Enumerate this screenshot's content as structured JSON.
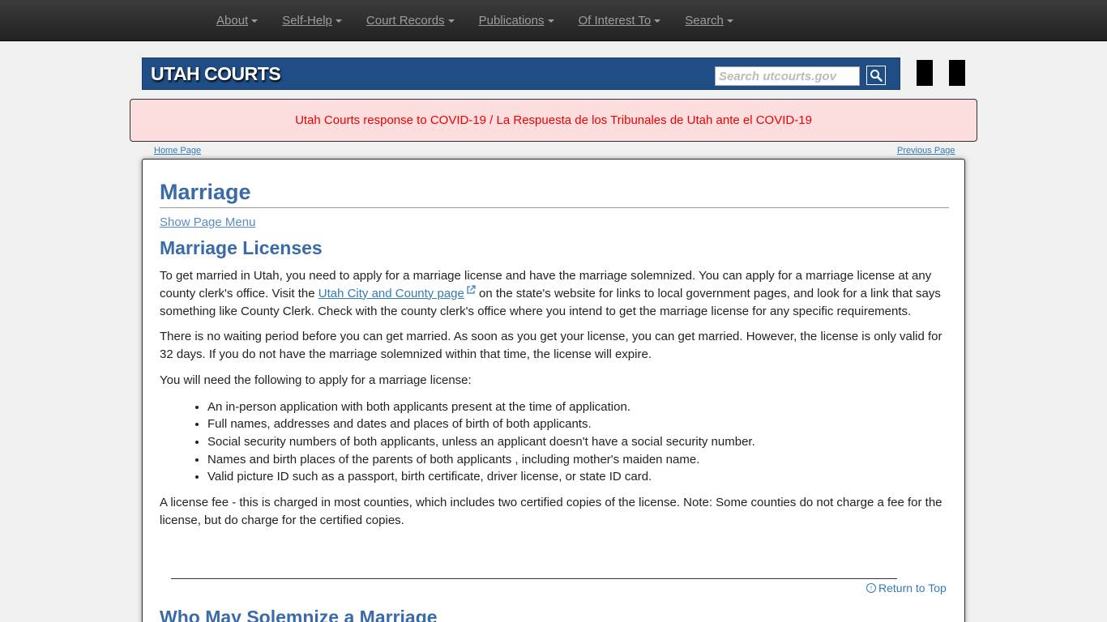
{
  "nav": {
    "items": [
      {
        "label": "About"
      },
      {
        "label": "Self-Help"
      },
      {
        "label": "Court Records"
      },
      {
        "label": "Publications"
      },
      {
        "label": "Of Interest To"
      },
      {
        "label": "Search"
      }
    ]
  },
  "header": {
    "brand": "UTAH COURTS",
    "search_placeholder": "Search utcourts.gov",
    "search_icon": "search-icon"
  },
  "alert": {
    "text": "Utah Courts response to COVID-19 / La Respuesta de los Tribunales de Utah ante el COVID-19",
    "color": "#ee0000",
    "background": "#fcdede"
  },
  "crumbs": {
    "home": "Home Page",
    "previous": "Previous Page"
  },
  "main": {
    "title": "Marriage",
    "show_menu": "Show Page Menu",
    "section1_title": "Marriage Licenses",
    "p1_before": "To get married in Utah, you need to apply for a marriage license and have the marriage solemnized. You can apply for a marriage license at any county clerk's office. Visit the ",
    "p1_link": "Utah City and County page",
    "p1_after": " on the state's website for links to local government pages, and look for a link that says something like County Clerk. Check with the county clerk's office where you intend to get the marriage license for any specific requirements.",
    "p2": "There is no waiting period before you can get married. As soon as you get your license, you can get married. However, the license is only valid for 32 days. If you do not have the marriage solemnized within that time, the license will expire.",
    "p3": "You will need the following to apply for a marriage license:",
    "requirements": [
      "An in-person application with both applicants present at the time of application.",
      "Full names, addresses and dates and places of birth of both applicants.",
      "Social security numbers of both applicants, unless an applicant doesn't have a social security number.",
      "Names and birth places of the parents of both applicants , including mother's maiden name.",
      "Valid picture ID such as a passport, birth certificate, driver license, or state ID card."
    ],
    "p4": "A license fee - this is charged in most counties, which includes two certified copies of the license. Note: Some counties do not charge a fee for the license, but do charge for the certified copies.",
    "return_top": "Return to Top",
    "section2_title": "Who May Solemnize a Marriage"
  },
  "colors": {
    "heading": "#3a6aa8",
    "banner": "#1f4e86",
    "link": "#337ab7"
  }
}
